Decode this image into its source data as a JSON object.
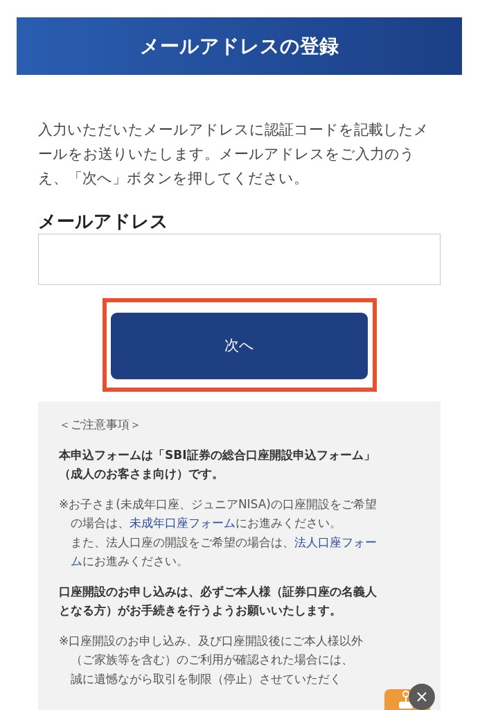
{
  "header": {
    "title": "メールアドレスの登録"
  },
  "intro": [
    "入力いただいたメールアドレスに認証コードを記載したメ",
    "ールをお送りいたします。メールアドレスをご入力のう",
    "え、「次へ」ボタンを押してください。"
  ],
  "email_field": {
    "label": "メールアドレス"
  },
  "next_button": {
    "label": "次へ",
    "highlighted": true
  },
  "notes": [
    {
      "kind": "heading",
      "lines": [
        [
          {
            "kind": "text",
            "text": "＜ご注意事項＞"
          }
        ]
      ]
    },
    {
      "kind": "bold",
      "lines": [
        [
          {
            "kind": "text",
            "text": "本申込フォームは「SBI証券の総合口座開設申込フォーム」"
          }
        ],
        [
          {
            "kind": "text",
            "text": "（成人のお客さま向け）です。"
          }
        ]
      ]
    },
    {
      "kind": "note",
      "lines": [
        [
          {
            "kind": "text",
            "text": "※お子さま(未成年口座、ジュニアNISA)の口座開設をご希望"
          }
        ],
        [
          {
            "kind": "text",
            "text": "の場合は、"
          },
          {
            "kind": "link",
            "text": "未成年口座フォーム"
          },
          {
            "kind": "text",
            "text": "にお進みください。"
          }
        ],
        [
          {
            "kind": "text",
            "text": "また、法人口座の開設をご希望の場合は、"
          },
          {
            "kind": "link",
            "text": "法人口座フォー"
          }
        ],
        [
          {
            "kind": "link",
            "text": "ム"
          },
          {
            "kind": "text",
            "text": "にお進みください。"
          }
        ]
      ]
    },
    {
      "kind": "bold",
      "lines": [
        [
          {
            "kind": "text",
            "text": "口座開設のお申し込みは、必ずご本人様（証券口座の名義人"
          }
        ],
        [
          {
            "kind": "text",
            "text": "となる方）がお手続きを行うようお願いいたします。"
          }
        ]
      ]
    },
    {
      "kind": "note",
      "lines": [
        [
          {
            "kind": "text",
            "text": "※口座開設のお申し込み、及び口座開設後にご本人様以外"
          }
        ],
        [
          {
            "kind": "text",
            "text": "（ご家族等を含む）のご利用が確認された場合には、"
          }
        ],
        [
          {
            "kind": "text",
            "text": "誠に遺憾ながら取引を制限（停止）させていただく"
          }
        ]
      ]
    }
  ]
}
